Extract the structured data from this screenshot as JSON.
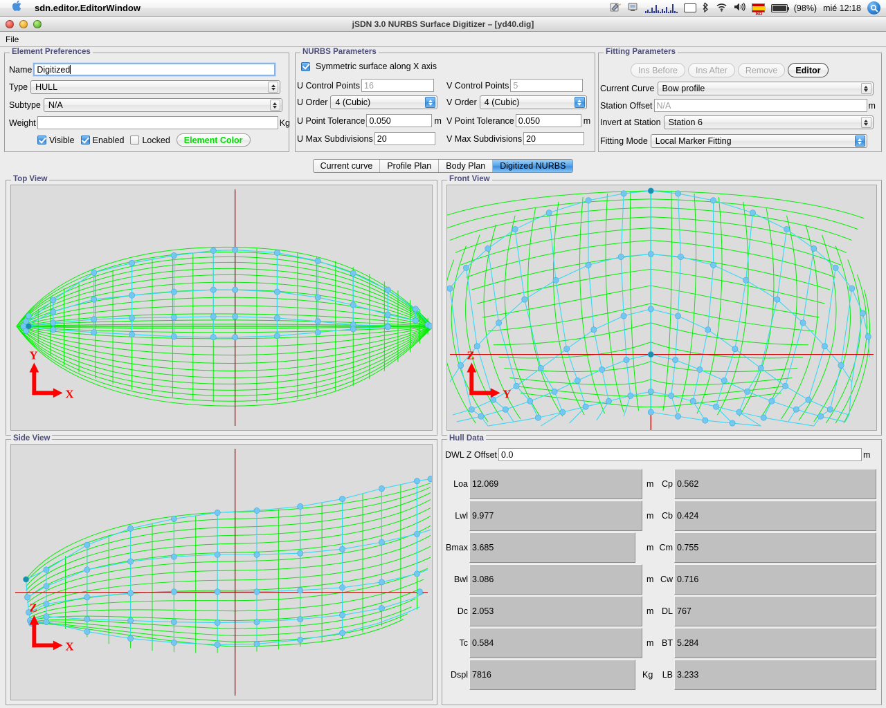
{
  "menubar": {
    "apple_icon": "apple-icon",
    "app_name": "sdn.editor.EditorWindow",
    "status_items": [
      {
        "name": "script-editor-icon",
        "glyph": "✎"
      },
      {
        "name": "display-mirror-icon",
        "glyph": "❐"
      },
      {
        "name": "audio-spectrum-icon",
        "glyph": ""
      },
      {
        "name": "display-icon",
        "glyph": ""
      },
      {
        "name": "bluetooth-icon",
        "glyph": "฿"
      },
      {
        "name": "wifi-icon",
        "glyph": "◜"
      },
      {
        "name": "volume-icon",
        "glyph": "◂"
      },
      {
        "name": "keyboard-flag-icon",
        "label": "ISO"
      },
      {
        "name": "battery-icon",
        "label": "(98%)"
      },
      {
        "name": "clock",
        "label": "mié 12:18"
      },
      {
        "name": "spotlight-icon",
        "glyph": "⚲"
      }
    ],
    "battery_percent": "(98%)",
    "keyboard_layout": "ISO",
    "clock": "mié 12:18"
  },
  "window": {
    "title": "jSDN 3.0 NURBS Surface Digitizer – [yd40.dig]",
    "menu": [
      {
        "label": "File"
      }
    ]
  },
  "element_preferences": {
    "legend": "Element Preferences",
    "name_label": "Name",
    "name_value": "Digitized",
    "type_label": "Type",
    "type_value": "HULL",
    "subtype_label": "Subtype",
    "subtype_value": "N/A",
    "weight_label": "Weight",
    "weight_value": "",
    "weight_unit": "Kg",
    "visible_label": "Visible",
    "visible_checked": true,
    "enabled_label": "Enabled",
    "enabled_checked": true,
    "locked_label": "Locked",
    "locked_checked": false,
    "element_color_label": "Element Color",
    "element_color_hex": "#00dd00"
  },
  "nurbs_parameters": {
    "legend": "NURBS Parameters",
    "symmetric_label": "Symmetric surface along X axis",
    "symmetric_checked": true,
    "u_control_points_label": "U Control Points",
    "u_control_points_value": "16",
    "v_control_points_label": "V Control Points",
    "v_control_points_value": "5",
    "u_order_label": "U Order",
    "u_order_value": "4 (Cubic)",
    "v_order_label": "V Order",
    "v_order_value": "4 (Cubic)",
    "u_point_tolerance_label": "U Point Tolerance",
    "u_point_tolerance_value": "0.050",
    "u_point_tolerance_unit": "m",
    "v_point_tolerance_label": "V Point Tolerance",
    "v_point_tolerance_value": "0.050",
    "v_point_tolerance_unit": "m",
    "u_max_subdivisions_label": "U Max Subdivisions",
    "u_max_subdivisions_value": "20",
    "v_max_subdivisions_label": "V Max Subdivisions",
    "v_max_subdivisions_value": "20"
  },
  "fitting_parameters": {
    "legend": "Fitting Parameters",
    "ins_before_label": "Ins Before",
    "ins_after_label": "Ins After",
    "remove_label": "Remove",
    "editor_label": "Editor",
    "current_curve_label": "Current Curve",
    "current_curve_value": "Bow profile",
    "station_offset_label": "Station Offset",
    "station_offset_value": "N/A",
    "station_offset_unit": "m",
    "invert_at_station_label": "Invert at Station",
    "invert_at_station_value": "Station 6",
    "fitting_mode_label": "Fitting Mode",
    "fitting_mode_value": "Local Marker Fitting"
  },
  "tabs": [
    {
      "label": "Current curve",
      "selected": false
    },
    {
      "label": "Profile Plan",
      "selected": false
    },
    {
      "label": "Body Plan",
      "selected": false
    },
    {
      "label": "Digitized NURBS",
      "selected": true
    }
  ],
  "views": {
    "top": {
      "legend": "Top View",
      "axis_vertical": "Y",
      "axis_horizontal": "X"
    },
    "front": {
      "legend": "Front View",
      "axis_vertical": "Z",
      "axis_horizontal": "Y"
    },
    "side": {
      "legend": "Side View",
      "axis_vertical": "Z",
      "axis_horizontal": "X"
    }
  },
  "colors": {
    "surface_mesh": "#00ee00",
    "control_polygon": "#35d8f5",
    "control_point": "#74c8f0",
    "axis_crosshair": "#cc0000",
    "viewport_background": "#dcdcdc",
    "panel_background": "#ececec",
    "legend_text": "#4d4d7a"
  },
  "hull_data": {
    "legend": "Hull Data",
    "dwl_label": "DWL Z Offset",
    "dwl_value": "0.0",
    "dwl_unit": "m",
    "left_rows": [
      {
        "label": "Loa",
        "value": "12.069",
        "unit": "m"
      },
      {
        "label": "Lwl",
        "value": "9.977",
        "unit": "m"
      },
      {
        "label": "Bmax",
        "value": "3.685",
        "unit": "m"
      },
      {
        "label": "Bwl",
        "value": "3.086",
        "unit": "m"
      },
      {
        "label": "Dc",
        "value": "2.053",
        "unit": "m"
      },
      {
        "label": "Tc",
        "value": "0.584",
        "unit": "m"
      },
      {
        "label": "Dspl",
        "value": "7816",
        "unit": "Kg"
      }
    ],
    "right_rows": [
      {
        "label": "Cp",
        "value": "0.562"
      },
      {
        "label": "Cb",
        "value": "0.424"
      },
      {
        "label": "Cm",
        "value": "0.755"
      },
      {
        "label": "Cw",
        "value": "0.716"
      },
      {
        "label": "DL",
        "value": "767"
      },
      {
        "label": "BT",
        "value": "5.284"
      },
      {
        "label": "LB",
        "value": "3.233"
      }
    ]
  }
}
